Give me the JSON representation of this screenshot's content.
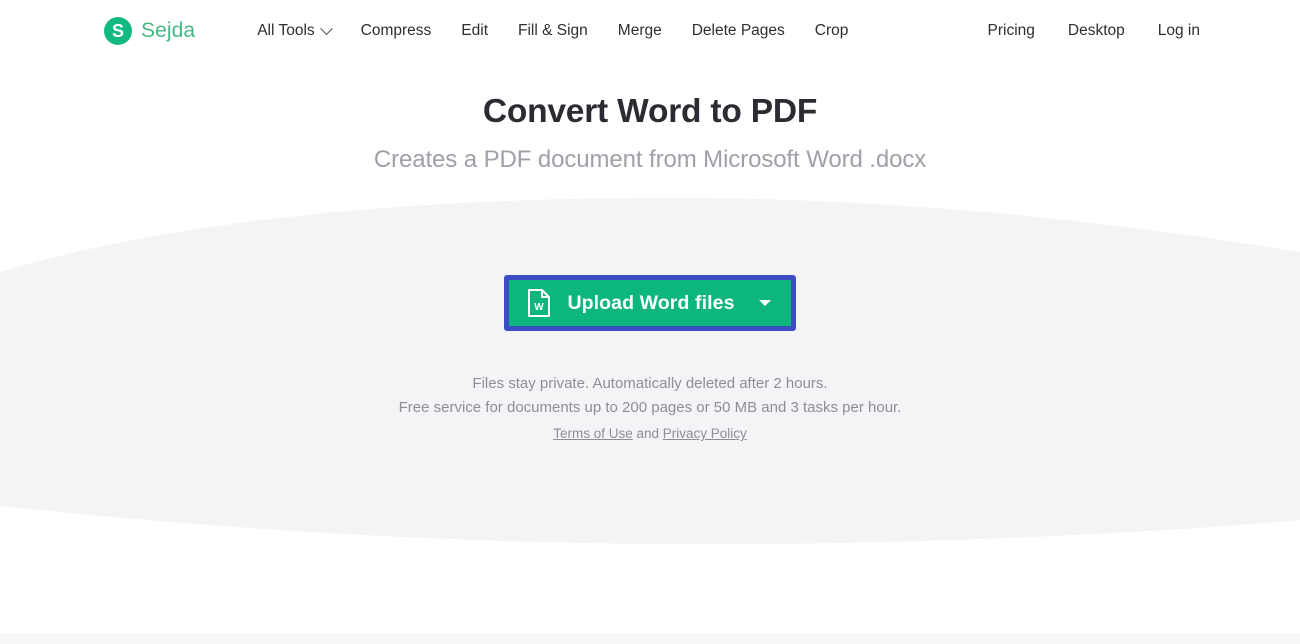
{
  "colors": {
    "brand_green": "#12b981",
    "brand_text_green": "#48b883",
    "button_green": "#0cb67c",
    "focus_outline_blue": "#3c4cc3",
    "wave_gray": "#f4f3f6",
    "muted_text": "#8e8e96",
    "heading_text": "#2b2b32",
    "subheading_text": "#a0a0a8"
  },
  "header": {
    "brand": {
      "logo_letter": "S",
      "name": "Sejda",
      "logo_icon": "sejda-circle-logo-icon"
    },
    "nav_left": [
      {
        "label": "All Tools",
        "has_chevron": true,
        "icon": "chevron-down-icon"
      },
      {
        "label": "Compress",
        "has_chevron": false
      },
      {
        "label": "Edit",
        "has_chevron": false
      },
      {
        "label": "Fill & Sign",
        "has_chevron": false
      },
      {
        "label": "Merge",
        "has_chevron": false
      },
      {
        "label": "Delete Pages",
        "has_chevron": false
      },
      {
        "label": "Crop",
        "has_chevron": false
      }
    ],
    "nav_right": [
      {
        "label": "Pricing"
      },
      {
        "label": "Desktop"
      },
      {
        "label": "Log in"
      }
    ]
  },
  "hero": {
    "title": "Convert Word to PDF",
    "subtitle": "Creates a PDF document from Microsoft Word .docx"
  },
  "upload": {
    "button_label": "Upload Word files",
    "file_icon": "word-document-icon",
    "file_icon_letter": "W",
    "dropdown_icon": "caret-down-icon"
  },
  "notes": {
    "line1": "Files stay private. Automatically deleted after 2 hours.",
    "line2": "Free service for documents up to 200 pages or 50 MB and 3 tasks per hour."
  },
  "legal": {
    "terms_label": "Terms of Use",
    "conjunction": " and ",
    "privacy_label": "Privacy Policy"
  }
}
